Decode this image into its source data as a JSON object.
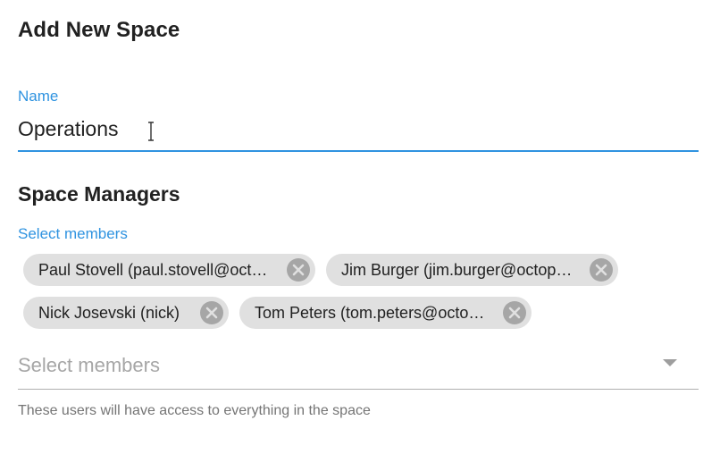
{
  "dialog": {
    "title": "Add New Space"
  },
  "name_field": {
    "label": "Name",
    "value": "Operations"
  },
  "space_managers": {
    "title": "Space Managers",
    "members_label": "Select members",
    "chips": [
      {
        "label": "Paul Stovell (paul.stovell@oct…"
      },
      {
        "label": "Jim Burger (jim.burger@octop…"
      },
      {
        "label": "Nick Josevski (nick)"
      },
      {
        "label": "Tom Peters (tom.peters@octo…"
      }
    ],
    "select_placeholder": "Select members",
    "helper_text": "These users will have access to everything in the space"
  },
  "icons": {
    "chip_remove": "close-circle-icon",
    "dropdown": "dropdown-arrow-icon",
    "cursor": "text-cursor-icon"
  },
  "colors": {
    "accent": "#2f93e0",
    "chip_background": "#e0e0e0",
    "chip_remove_icon": "#a6a6a6"
  }
}
